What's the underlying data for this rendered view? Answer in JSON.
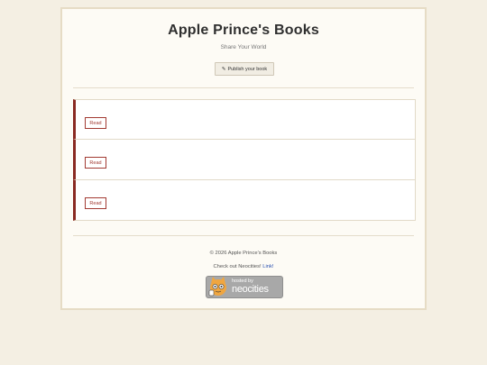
{
  "header": {
    "title": "Apple Prince's Books",
    "tagline": "Share Your World",
    "publish_label": "Publish your book",
    "publish_icon": "pencil-icon"
  },
  "books": [
    {
      "read_label": "Read"
    },
    {
      "read_label": "Read"
    },
    {
      "read_label": "Read"
    }
  ],
  "footer": {
    "copyright": "© 2026 Apple Prince's Books",
    "checkout_prefix": "Check out Neocities! ",
    "checkout_link": "Link!",
    "badge_small": "hosted by",
    "badge_big": "neocities"
  },
  "colors": {
    "accent": "#8a2a22",
    "background": "#f4efe3",
    "card": "#fdfbf5",
    "link": "#2a50b0"
  }
}
